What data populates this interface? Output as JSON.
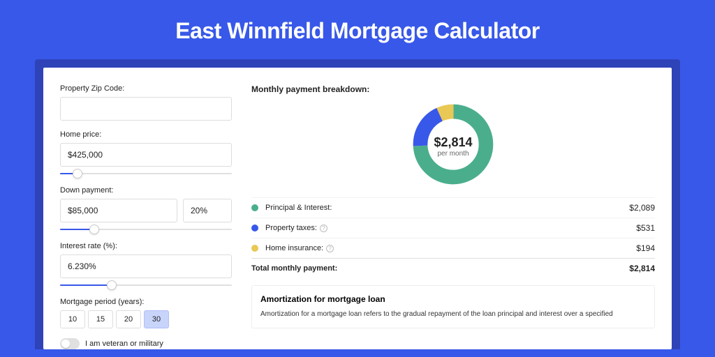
{
  "title": "East Winnfield Mortgage Calculator",
  "form": {
    "zip_label": "Property Zip Code:",
    "zip_value": "",
    "home_price_label": "Home price:",
    "home_price_value": "$425,000",
    "down_payment_label": "Down payment:",
    "down_payment_value": "$85,000",
    "down_payment_pct": "20%",
    "interest_label": "Interest rate (%):",
    "interest_value": "6.230%",
    "period_label": "Mortgage period (years):",
    "periods": [
      "10",
      "15",
      "20",
      "30"
    ],
    "period_selected": "30",
    "veteran_label": "I am veteran or military"
  },
  "breakdown": {
    "title": "Monthly payment breakdown:",
    "center_value": "$2,814",
    "center_label": "per month",
    "rows": [
      {
        "key": "principal",
        "label": "Principal & Interest:",
        "value": "$2,089",
        "color": "#4AAE8C",
        "info": false
      },
      {
        "key": "taxes",
        "label": "Property taxes:",
        "value": "$531",
        "color": "#3858E9",
        "info": true
      },
      {
        "key": "insurance",
        "label": "Home insurance:",
        "value": "$194",
        "color": "#E9C855",
        "info": true
      }
    ],
    "total_label": "Total monthly payment:",
    "total_value": "$2,814"
  },
  "amort": {
    "title": "Amortization for mortgage loan",
    "desc": "Amortization for a mortgage loan refers to the gradual repayment of the loan principal and interest over a specified"
  },
  "chart_data": {
    "type": "pie",
    "title": "Monthly payment breakdown",
    "series": [
      {
        "name": "Principal & Interest",
        "value": 2089,
        "color": "#4AAE8C"
      },
      {
        "name": "Property taxes",
        "value": 531,
        "color": "#3858E9"
      },
      {
        "name": "Home insurance",
        "value": 194,
        "color": "#E9C855"
      }
    ],
    "total": 2814,
    "center_label": "$2,814 per month"
  }
}
